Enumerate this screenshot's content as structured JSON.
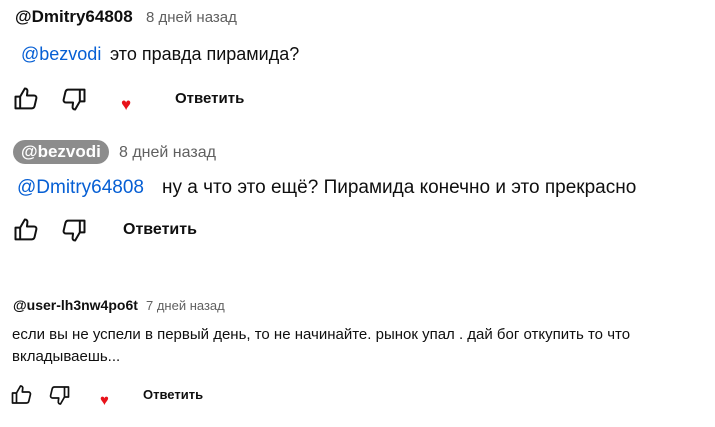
{
  "comments": [
    {
      "author": "@Dmitry64808",
      "time": "8 дней назад",
      "mention": "@bezvodi",
      "text": "это правда пирамида?",
      "reply_label": "Ответить",
      "hearted": true
    },
    {
      "author": "@bezvodi",
      "time": "8 дней назад",
      "mention": "@Dmitry64808",
      "text": "ну а что это ещё? Пирамида конечно и это прекрасно",
      "reply_label": "Ответить",
      "hearted": false
    },
    {
      "author": "@user-lh3nw4po6t",
      "time": "7 дней назад",
      "text": "если вы не успели в первый день, то не начинайте. рынок упал . дай бог откупить то что вкладываешь...",
      "reply_label": "Ответить",
      "hearted": true
    }
  ],
  "icons": {
    "like": "thumbs-up-icon",
    "dislike": "thumbs-down-icon",
    "heart": "heart-icon",
    "heart_color": "#e8121a"
  }
}
